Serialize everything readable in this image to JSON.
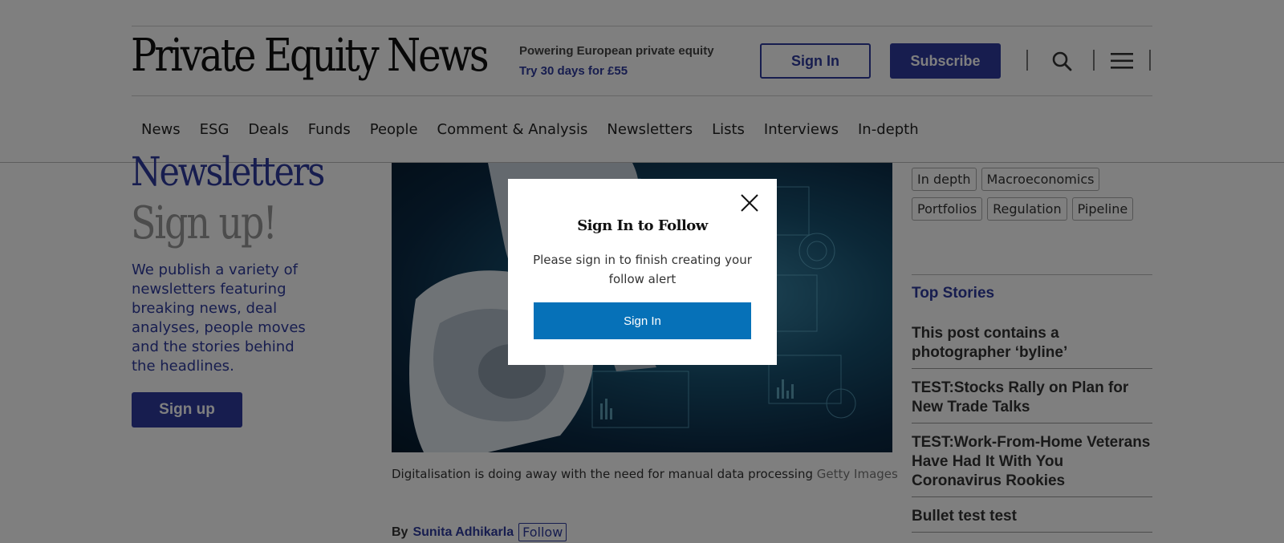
{
  "header": {
    "logo": "Private Equity News",
    "tagline": "Powering European private equity",
    "trial_offer": "Try 30 days for £55",
    "sign_in_label": "Sign In",
    "subscribe_label": "Subscribe"
  },
  "nav": {
    "items": [
      "News",
      "ESG",
      "Deals",
      "Funds",
      "People",
      "Comment & Analysis",
      "Newsletters",
      "Lists",
      "Interviews",
      "In-depth"
    ]
  },
  "newsletter_promo": {
    "title": "Newsletters",
    "subtitle": "Sign up!",
    "description": "We publish a variety of newsletters featuring breaking news, deal analyses, people moves and the stories behind the headlines.",
    "button_label": "Sign up"
  },
  "article": {
    "caption": "Digitalisation is doing away with the need for manual data processing",
    "image_credit": "Getty Images",
    "byline_prefix": "By",
    "author": "Sunita Adhikarla",
    "follow_label": "Follow"
  },
  "sidebar": {
    "tags": [
      "In depth",
      "Macroeconomics",
      "Portfolios",
      "Regulation",
      "Pipeline"
    ],
    "top_stories_title": "Top Stories",
    "stories": [
      "This post contains a photographer ‘byline’",
      "TEST:Stocks Rally on Plan for New Trade Talks",
      "TEST:Work-From-Home Veterans Have Had It With You Coronavirus Rookies",
      "Bullet test test"
    ]
  },
  "modal": {
    "title": "Sign In to Follow",
    "message": "Please sign in to finish creating your follow alert",
    "button_label": "Sign In"
  },
  "colors": {
    "brand": "#2e3b9e",
    "modal_button": "#0671b8",
    "overlay": "rgba(0,0,0,0.5)"
  }
}
